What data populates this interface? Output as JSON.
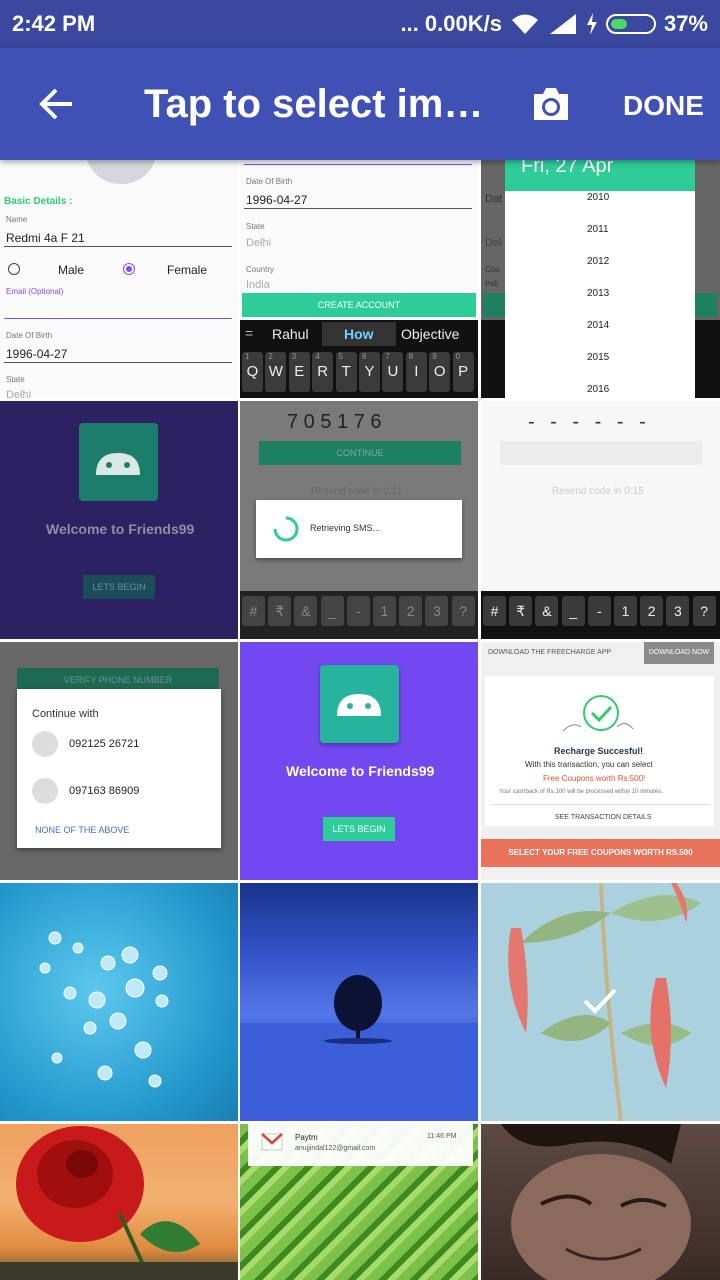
{
  "status_bar": {
    "time": "2:42 PM",
    "network_speed": "... 0.00K/s",
    "battery_percent": "37%",
    "battery_level": 0.37,
    "icons": [
      "wifi-icon",
      "signal-icon",
      "charging-icon",
      "battery-icon"
    ]
  },
  "app_bar": {
    "title": "Tap to select ima...",
    "done_label": "DONE",
    "icons": [
      "back-arrow-icon",
      "camera-icon"
    ],
    "color": "#3f51b5"
  },
  "thumbs": {
    "t1": {
      "section": "Basic Details :",
      "name_label": "Name",
      "name_value": "Redmi 4a F 21",
      "male": "Male",
      "female": "Female",
      "email_label": "Email (Optional)",
      "dob_label": "Date Of Birth",
      "dob_value": "1996-04-27",
      "state_label": "State",
      "state_value": "Delhi"
    },
    "t2": {
      "dob_label": "Date Of Birth",
      "dob_value": "1996-04-27",
      "state_label": "State",
      "state_value": "Delhi",
      "country_label": "Country",
      "country_value": "India",
      "create_button": "CREATE ACCOUNT",
      "suggestions": [
        "Rahul",
        "How",
        "Objective"
      ],
      "number_row": [
        "1",
        "2",
        "3",
        "4",
        "5",
        "6",
        "7",
        "8",
        "9",
        "0"
      ],
      "keys": [
        "Q",
        "W",
        "E",
        "R",
        "T",
        "Y",
        "U",
        "I",
        "O",
        "P"
      ]
    },
    "t3": {
      "header_date": "Fri, 27 Apr",
      "years": [
        "2010",
        "2011",
        "2012",
        "2013",
        "2014",
        "2015",
        "2016"
      ],
      "labels": [
        "Dat",
        "Del",
        "Cou",
        "Indi"
      ]
    },
    "t4": {
      "welcome": "Welcome to Friends99",
      "button": "LETS BEGIN"
    },
    "t5": {
      "otp": "7 0 5 1 7 6",
      "continue": "CONTINUE",
      "resend": "Resend code in 0:11",
      "dialog": "Retrieving SMS...",
      "keys": [
        "#",
        "₹",
        "&",
        "_",
        "-",
        "1",
        "2",
        "3",
        "?"
      ]
    },
    "t6": {
      "otp": "- - - - - -",
      "resend": "Resend code in 0:15",
      "keys": [
        "#",
        "₹",
        "&",
        "_",
        "-",
        "1",
        "2",
        "3",
        "?"
      ]
    },
    "t7": {
      "verify": "VERIFY PHONE NUMBER",
      "continue_with": "Continue with",
      "phone1": "092125 26721",
      "phone2": "097163 86909",
      "none": "NONE OF THE ABOVE"
    },
    "t8": {
      "welcome": "Welcome to Friends99",
      "button": "LETS BEGIN"
    },
    "t9": {
      "download_text": "DOWNLOAD THE FREECHARGE APP",
      "download_button": "DOWNLOAD NOW",
      "success": "Recharge Succesful!",
      "with_this": "With this transaction, you can select",
      "coupons": "Free Coupons worth Rs.500!",
      "cashback": "Your cashback of Rs.100 will be processed within 10 minutes.",
      "see_details": "SEE TRANSACTION DETAILS",
      "select_coupons": "SELECT YOUR FREE COUPONS WORTH RS.500"
    },
    "t14": {
      "app": "Paytm",
      "time": "11:46 PM",
      "email": "anujjindal122@gmail.com"
    }
  },
  "selected_thumb": "chillies-photo"
}
